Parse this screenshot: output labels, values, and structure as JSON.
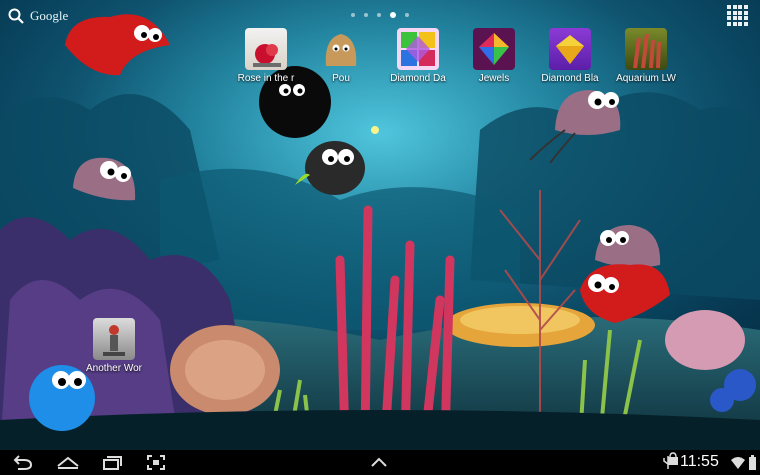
{
  "search": {
    "label": "Google",
    "icon": "search-icon"
  },
  "page_indicator": {
    "count": 5,
    "active_index": 3
  },
  "app_drawer": {
    "icon": "apps-grid-icon"
  },
  "apps": [
    {
      "label": "Rose in the r",
      "icon": "rose-app-icon"
    },
    {
      "label": "Pou",
      "icon": "pou-app-icon"
    },
    {
      "label": "Diamond Da",
      "icon": "diamond-dash-app-icon"
    },
    {
      "label": "Jewels",
      "icon": "jewels-app-icon"
    },
    {
      "label": "Diamond Bla",
      "icon": "diamond-blast-app-icon"
    },
    {
      "label": "Aquarium LW",
      "icon": "aquarium-lw-app-icon"
    },
    {
      "label": "Another Wor",
      "icon": "another-world-app-icon"
    }
  ],
  "navbar": {
    "back_icon": "back-icon",
    "home_icon": "home-icon",
    "recents_icon": "recent-apps-icon",
    "screenshot_icon": "screenshot-icon",
    "up_icon": "chevron-up-icon",
    "usb_icon": "usb-icon",
    "shop_icon": "shopping-bag-icon",
    "time": "11:55",
    "wifi_icon": "wifi-icon",
    "battery_icon": "battery-icon"
  },
  "colors": {
    "navbar": "#000000",
    "water": "#11718f",
    "text": "#ffffff"
  }
}
